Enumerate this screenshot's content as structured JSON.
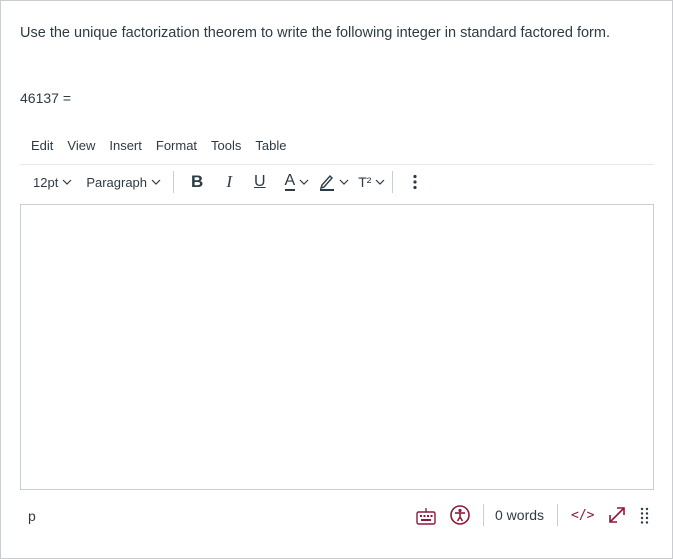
{
  "question": {
    "prompt": "Use the unique factorization theorem to write the following integer in standard factored form.",
    "equation": "46137 ="
  },
  "menubar": [
    "Edit",
    "View",
    "Insert",
    "Format",
    "Tools",
    "Table"
  ],
  "toolbar": {
    "font_size": "12pt",
    "block_format": "Paragraph",
    "bold": "B",
    "italic": "I",
    "underline": "U",
    "text_color": "A",
    "superscript": "T²"
  },
  "statusbar": {
    "element_path": "p",
    "word_count": "0 words",
    "html_editor": "</>"
  },
  "colors": {
    "text": "#2d3b45",
    "accent": "#8b1a3a",
    "border": "#c7cdd1"
  }
}
